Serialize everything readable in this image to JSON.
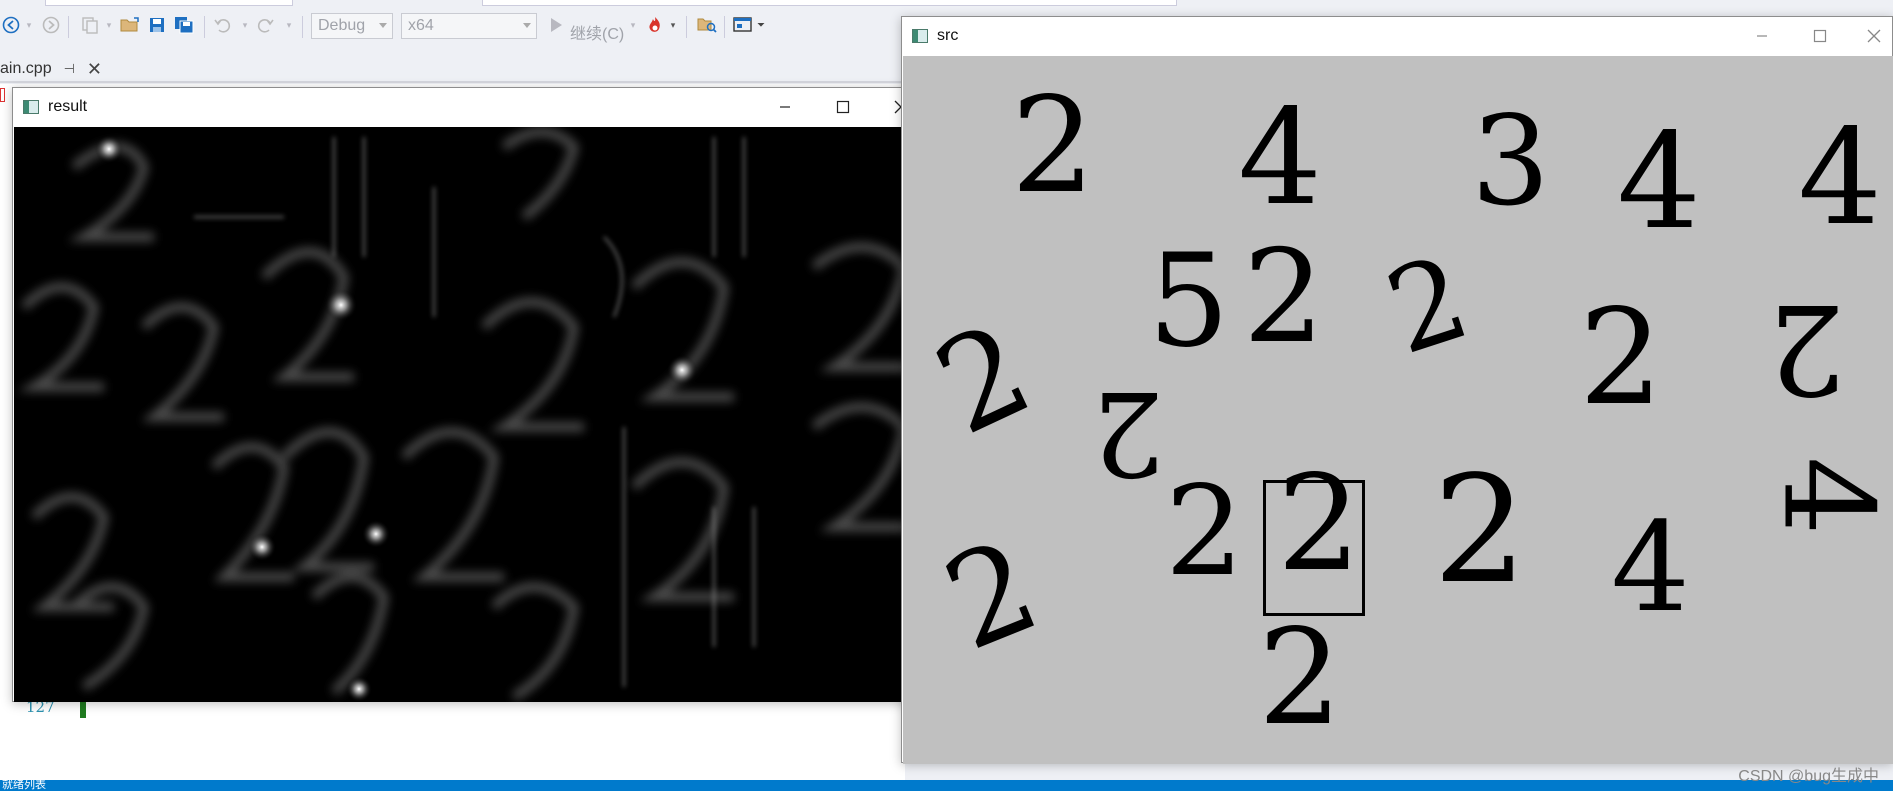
{
  "toolbar": {
    "config_label": "Debug",
    "platform_label": "x64",
    "continue_label": "继续(C)"
  },
  "editor": {
    "tab_label": "ain.cpp",
    "line_number": "127"
  },
  "status": {
    "text": "就绪列表"
  },
  "result_window": {
    "title": "result"
  },
  "src_window": {
    "title": "src",
    "digits": [
      "2",
      "4",
      "3",
      "4",
      "4",
      "5",
      "2",
      "2",
      "2",
      "2",
      "2",
      "2",
      "2",
      "2",
      "4",
      "2",
      "4",
      "2"
    ]
  },
  "watermark": "CSDN @bug生成中",
  "colors": {
    "accent": "#007acc",
    "src_bg": "#c0c0c0",
    "result_bg": "#000000"
  }
}
